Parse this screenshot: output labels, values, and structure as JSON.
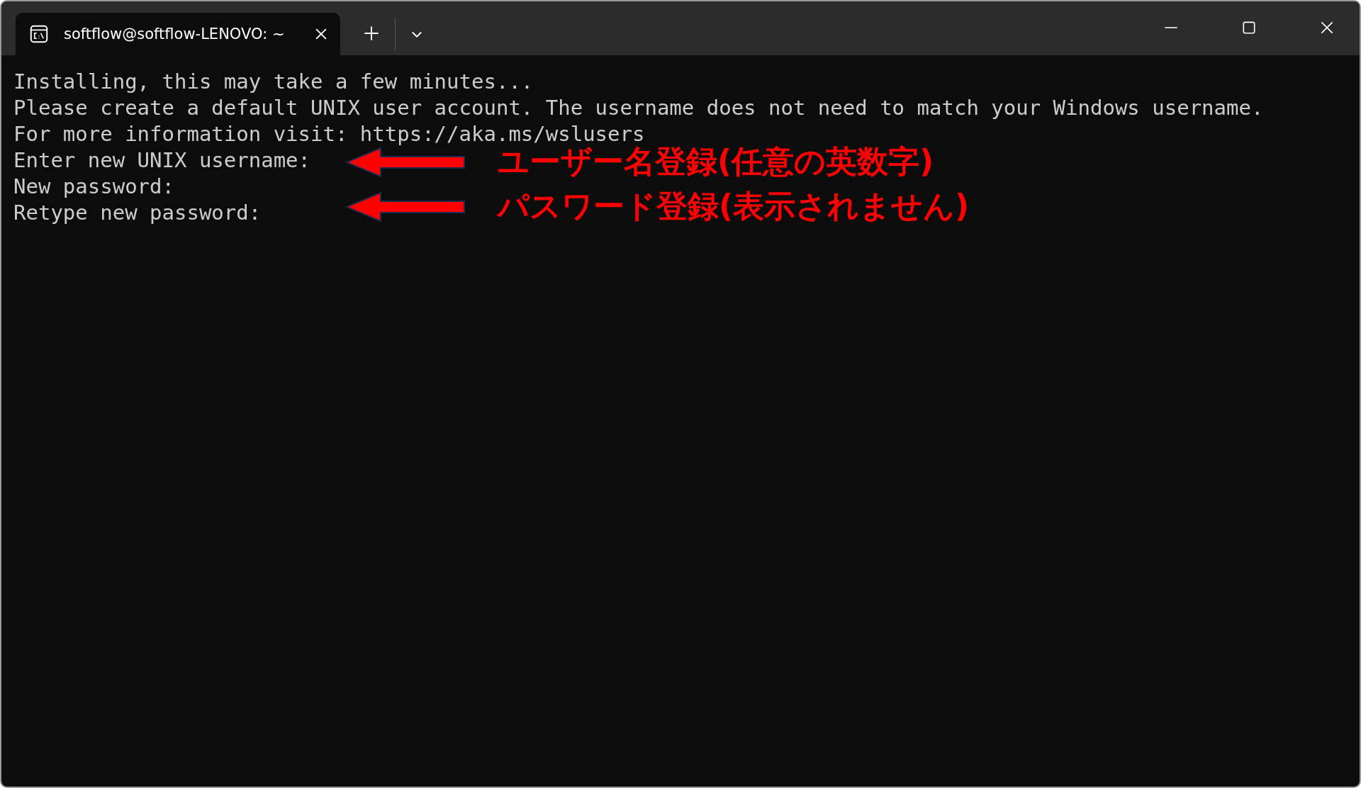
{
  "tabs": [
    {
      "title": "softflow@softflow-LENOVO: ~",
      "selected": true
    }
  ],
  "terminal": {
    "lines": [
      "Installing, this may take a few minutes...",
      "Please create a default UNIX user account. The username does not need to match your Windows username.",
      "For more information visit: https://aka.ms/wslusers",
      "Enter new UNIX username:",
      "New password:",
      "Retype new password:"
    ]
  },
  "annotations": [
    {
      "text": "ユーザー名登録(任意の英数字)"
    },
    {
      "text": "パスワード登録(表示されません)"
    }
  ]
}
